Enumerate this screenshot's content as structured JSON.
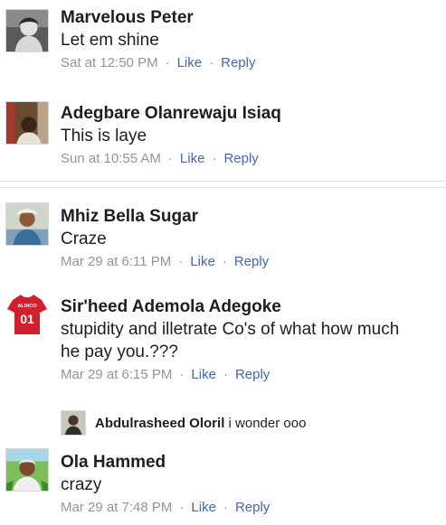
{
  "comments": [
    {
      "name": "Marvelous Peter",
      "text": "Let em shine",
      "time": "Sat at 12:50 PM",
      "like": "Like",
      "reply": "Reply"
    },
    {
      "name": "Adegbare Olanrewaju Isiaq",
      "text": "This is laye",
      "time": "Sun at 10:55 AM",
      "like": "Like",
      "reply": "Reply"
    },
    {
      "name": "Mhiz Bella Sugar",
      "text": "Craze",
      "time": "Mar 29 at 6:11 PM",
      "like": "Like",
      "reply": "Reply"
    },
    {
      "name": "Sir'heed Ademola Adegoke",
      "text_line1": "stupidity and illetrate Co's of what how much",
      "text_line2": "he pay you.???",
      "time": "Mar 29 at 6:15 PM",
      "like": "Like",
      "reply": "Reply",
      "avatar_badge_top": "ALINCO",
      "avatar_badge_number": "01"
    },
    {
      "name": "Ola Hammed",
      "text": "crazy",
      "time": "Mar 29 at 7:48 PM",
      "like": "Like",
      "reply": "Reply"
    }
  ],
  "nested_reply": {
    "name": "Abdulrasheed Oloril",
    "text": "i wonder ooo"
  },
  "separator_dot": "·",
  "colors": {
    "name": "#1c1e21",
    "meta": "#90949c",
    "action": "#4267b2",
    "divider": "#dddfe2",
    "jersey_red": "#d0202e"
  }
}
